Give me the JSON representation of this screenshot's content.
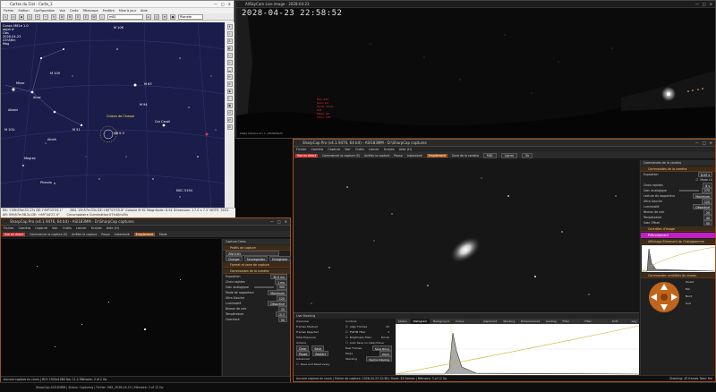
{
  "stellarium": {
    "title": "Cartes du Ciel - Carte_1",
    "menu": [
      "Fichier",
      "Edition",
      "Configuration",
      "Voir",
      "Carte",
      "Télescope",
      "Fenêtre",
      "Mise à jour",
      "Aide"
    ],
    "search_value": "m81",
    "object_list": "Planete",
    "info_lines": [
      "Const: M81e 1.0",
      "objet d'",
      "Obs",
      "2028-04-23",
      "22h58m",
      "Mag"
    ],
    "labels": {
      "m106": "M 106",
      "chien": "Chiens de Chasse",
      "cor_caroli": "Cor Caroli",
      "m63": "M 63",
      "m94": "M 94",
      "m51": "M 51",
      "m101": "M 101",
      "m109": "M 109",
      "mizar": "Mizar",
      "alcor": "Alcor",
      "alioth": "Alioth",
      "mega": "Megrez",
      "phad": "Phecda",
      "alkaid": "Alkaid",
      "target": "NB 0.3",
      "ngc": "NGC 5194"
    },
    "status_line1": "RA: +09h55m33.17s DE:+69°03'55.1\"",
    "status_line2": "AR: 09h57m38.2s DE: +69°44'27.4\"",
    "status_right1": "M81 10h57m33s DE:+69°03'55.8\" Galaxie M 81 Magnitude: 6.94 Dimension: 17.0 x 7.2' NOTE: 3031",
    "status_right2": "Circumpolaire  Culmination:07h40m45s"
  },
  "allsky": {
    "title": "AllSkyCam Live image - 2028-04-23",
    "datetime": "2028-04-23 22:58:52",
    "red_info": [
      "Exp: 60s",
      "Gain: 10",
      "Temp: 15.2C",
      "ISO",
      "Mean: 42",
      "Stars: 128"
    ],
    "bottom_text": "Allsky Camera v2 | 1 | 2028/04/23"
  },
  "sharpcap_small": {
    "title": "SharpCap Pro (v4.1.9476, 64 bit) - ASI183MM - D:\\SharpCap captures",
    "menu": [
      "Fichier",
      "Caméra",
      "Capture",
      "Voir",
      "Outils",
      "Lancer",
      "Scripts",
      "Aide (H)"
    ],
    "toolbar": [
      "Vue en direct",
      "Commencer la capture (S)",
      "Arrêter la capture",
      "Pause",
      "Instantané",
      "Empilement",
      "Mode"
    ],
    "panel_tab": "Capture Cams",
    "sections": [
      "Profils de capture",
      "Format et zone de capture",
      "Commandes de la caméra"
    ],
    "profile_value": "ZWO183",
    "profile_buttons": [
      "Charger",
      "Sauvegarder",
      "Enregistrer",
      "Supprimer"
    ],
    "rows": [
      {
        "label": "Exposition",
        "value": "30.0 ms"
      },
      {
        "label": "Choix rapides",
        "value": "1 ms"
      },
      {
        "label": "Gain analogique",
        "value": "300"
      },
      {
        "label": "Mode de rapporteur",
        "value": "Maximum"
      },
      {
        "label": "Ultra Gauche",
        "value": "120"
      },
      {
        "label": "Luminosité",
        "value": "Désactivé"
      },
      {
        "label": "Niveau de noir",
        "value": "20"
      },
      {
        "label": "Température",
        "value": "15.3"
      },
      {
        "label": "Overclock",
        "value": "50"
      }
    ],
    "status": "Aucune capture en cours | ROI: 1920x1080  fps: 11.2  Mémoire: 3 of 2 Go"
  },
  "sharpcap_main": {
    "title": "SharpCap Pro (v4.1.9476, 64 bit) - ASI183MM - D:\\SharpCap captures",
    "menu": [
      "Fichier",
      "Caméra",
      "Capture",
      "Voir",
      "Outils",
      "Lancer",
      "Scripts",
      "Aide (H)"
    ],
    "toolbar": [
      "Vue en direct",
      "Commencer la capture (S)",
      "Arrêter la capture",
      "Pause",
      "Instantané",
      "Empilement",
      "Zone de la caméra"
    ],
    "toolbar_select1": "M81",
    "toolbar_select2": "Lignes",
    "toolbar_select3": "Zo",
    "panel_tab": "Commandes de la caméra",
    "sections": [
      "Commandes de la caméra",
      "Contrôles d'image",
      "Prétraitement",
      "Affichage Étirement de l'histogramme",
      "Commandes contrôles du niveau"
    ],
    "purple_label": "Prétraitement",
    "rows": [
      {
        "label": "Exposition",
        "value": "8.00 s"
      },
      {
        "label": "Choix rapides",
        "value": "8 s"
      },
      {
        "label": "Gain analogique",
        "value": "270"
      },
      {
        "label": "Lecture du rapporteur",
        "value": "Maximum"
      },
      {
        "label": "Ultra Gauche",
        "value": "120"
      },
      {
        "label": "Luminosité",
        "value": "Désactivé"
      },
      {
        "label": "Niveau de noir",
        "value": "20"
      },
      {
        "label": "Température",
        "value": "40"
      },
      {
        "label": "Gain Offset",
        "value": "50"
      }
    ],
    "mode_label": "Mode LX",
    "pier_labels": [
      "Ouest",
      "Est",
      "Nord",
      "Sud"
    ],
    "status": "Aucune capture en cours | Fichier de capture: 2028-04-23 22:58 | Stack: 45 frames | Mémoire: 3 of 12 Go",
    "status_right": "Stacking: 45 frames  Total: 6m"
  },
  "live_stack": {
    "tabs": [
      "Status",
      "Histogram",
      "Background",
      "Colour Calibration",
      "Alignment",
      "Stacking",
      "Enhancement",
      "Guiding",
      "Filter (FWHM)",
      "Filter (Brightness)",
      "Drift Graph",
      "Log"
    ],
    "active_tab": "Histogram",
    "header": "Live Stacking",
    "overview_label": "Overview",
    "stats": [
      {
        "label": "Frames Stacked",
        "value": "45"
      },
      {
        "label": "Frames Rejected",
        "value": "3"
      },
      {
        "label": "Total Exposure",
        "value": "6m 0s"
      }
    ],
    "controls_label": "Controls",
    "checks": [
      "Align Frames",
      "FWHM Filter",
      "Brightness Filter",
      "Auto Save on Clear/Close"
    ],
    "raw_frames_label": "Raw Frames",
    "raw_frames_value": "Save None",
    "mode_label": "Mode",
    "mode_value": "Stack",
    "stacking_label": "Stacking",
    "stacking_value": "Sigma Clipping",
    "action_label": "Actions",
    "buttons": [
      "Clear",
      "Save",
      "Pause",
      "Restart"
    ],
    "advanced_label": "Advanced",
    "advanced_opt": "Save and Reset every"
  },
  "bottom_status": "SharpCap ASI183MM | Status: Capturing | Fichier: M81_2028-04-23 | Mémoire: 3 of 12 Go"
}
